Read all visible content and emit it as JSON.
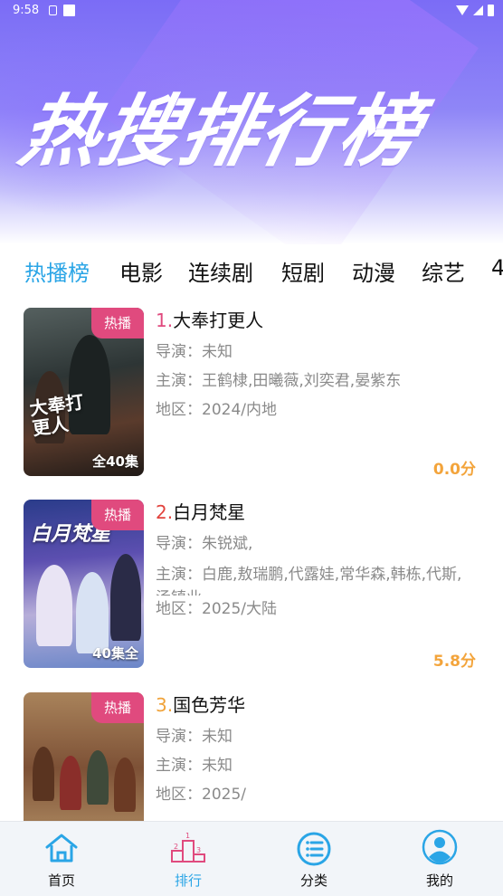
{
  "status_bar": {
    "time": "9:58",
    "icons": [
      "a-icon",
      "square-icon",
      "wifi-icon",
      "signal-icon",
      "battery-icon"
    ]
  },
  "hero": {
    "title": "热搜排行榜"
  },
  "tabs": [
    {
      "label": "热播榜",
      "active": true
    },
    {
      "label": "电影",
      "active": false
    },
    {
      "label": "连续剧",
      "active": false
    },
    {
      "label": "短剧",
      "active": false
    },
    {
      "label": "动漫",
      "active": false
    },
    {
      "label": "综艺",
      "active": false
    },
    {
      "label": "4",
      "active": false
    }
  ],
  "items": [
    {
      "rank": "1.",
      "title": "大奉打更人",
      "badge": "热播",
      "episodes": "全40集",
      "director": "导演：未知",
      "cast": "主演：王鹤棣,田曦薇,刘奕君,晏紫东",
      "region": "地区：2024/内地",
      "score": "0.0分",
      "poster_text": "大奉打更人"
    },
    {
      "rank": "2.",
      "title": "白月梵星",
      "badge": "热播",
      "episodes": "40集全",
      "director": "导演：朱锐斌,",
      "cast": "主演：白鹿,敖瑞鹏,代露娃,常华森,韩栋,代斯,汤镇业",
      "region": "地区：2025/大陆",
      "score": "5.8分",
      "poster_text": "白月梵星"
    },
    {
      "rank": "3.",
      "title": "国色芳华",
      "badge": "热播",
      "episodes": "",
      "director": "导演：未知",
      "cast": "主演：未知",
      "region": "地区：2025/",
      "score": "",
      "poster_text": ""
    }
  ],
  "bottom_nav": [
    {
      "label": "首页",
      "icon": "home-icon",
      "active": false
    },
    {
      "label": "排行",
      "icon": "podium-icon",
      "active": true
    },
    {
      "label": "分类",
      "icon": "list-icon",
      "active": false
    },
    {
      "label": "我的",
      "icon": "user-icon",
      "active": false
    }
  ],
  "colors": {
    "accent": "#2aa5e6",
    "badge": "#e04a7e",
    "score": "#f3a43b",
    "hero_top": "#7b6cf6"
  }
}
